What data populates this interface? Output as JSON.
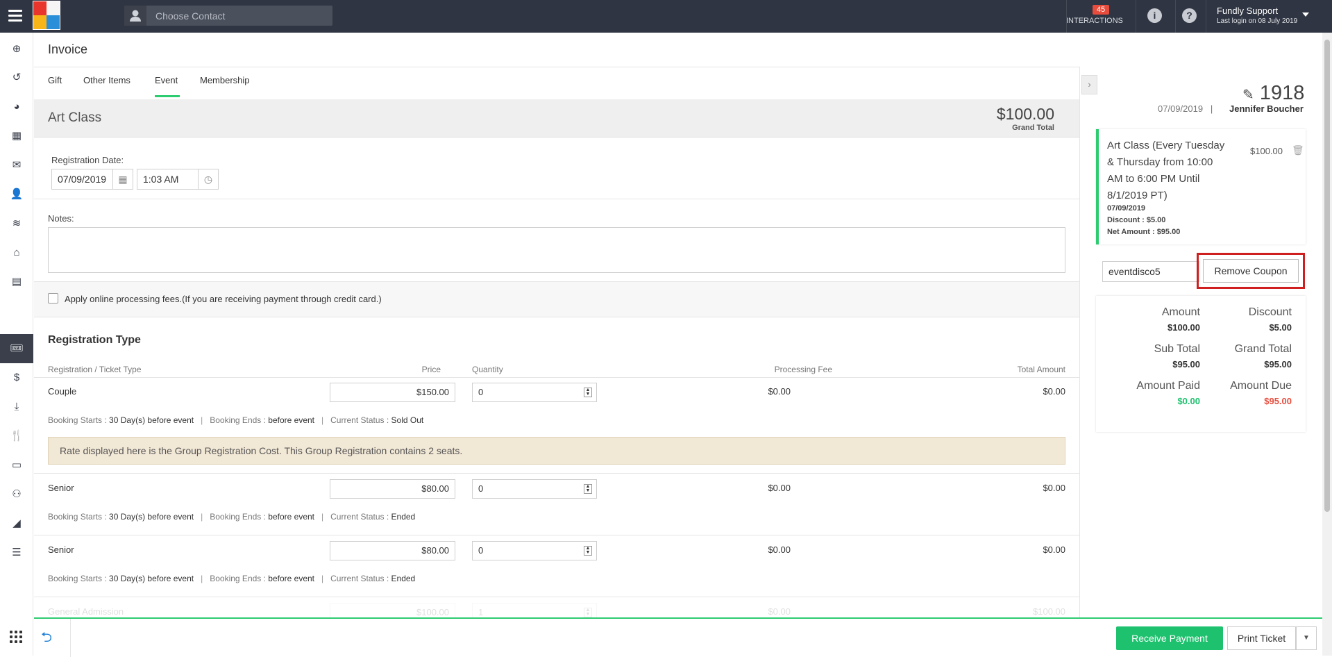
{
  "topbar": {
    "search_placeholder": "Choose Contact",
    "interactions_count": "45",
    "interactions_label": "INTERACTIONS",
    "user_name": "Fundly Support",
    "last_login": "Last login on 08 July 2019"
  },
  "colors": {
    "accent": "#2ecc71",
    "topbar": "#2f3542",
    "highlight": "#d01f1f"
  },
  "page": {
    "title": "Invoice",
    "tabs": [
      "Gift",
      "Other Items",
      "Event",
      "Membership"
    ],
    "active_tab": "Event"
  },
  "event": {
    "name": "Art Class",
    "grand_total": "$100.00",
    "grand_total_label": "Grand Total",
    "registration_date_label": "Registration Date:",
    "date": "07/09/2019",
    "time": "1:03 AM",
    "notes_label": "Notes:",
    "fees_label": "Apply online processing fees.(If you are receiving payment through credit card.)"
  },
  "registration": {
    "heading": "Registration Type",
    "headers": [
      "Registration / Ticket Type",
      "Price",
      "Quantity",
      "Processing Fee",
      "Total Amount"
    ],
    "rows": [
      {
        "type": "Couple",
        "price": "$150.00",
        "qty": "0",
        "fee": "$0.00",
        "total": "$0.00",
        "starts": "30 Day(s) before event",
        "ends": "before event",
        "status": "Sold Out"
      },
      {
        "type": "Senior",
        "price": "$80.00",
        "qty": "0",
        "fee": "$0.00",
        "total": "$0.00",
        "starts": "30 Day(s) before event",
        "ends": "before event",
        "status": "Ended"
      },
      {
        "type": "Senior",
        "price": "$80.00",
        "qty": "0",
        "fee": "$0.00",
        "total": "$0.00",
        "starts": "30 Day(s) before event",
        "ends": "before event",
        "status": "Ended"
      },
      {
        "type": "General Admission",
        "price": "$100.00",
        "qty": "1",
        "fee": "$0.00",
        "total": "$100.00"
      }
    ],
    "meta_labels": {
      "starts": "Booking Starts :",
      "ends": "Booking Ends :",
      "status": "Current Status :"
    },
    "group_note": "Rate displayed here is the Group Registration Cost. This Group Registration contains 2 seats."
  },
  "summary": {
    "invoice_no": "1918",
    "date": "07/09/2019",
    "sep": "|",
    "contact": "Jennifer Boucher",
    "item": {
      "title": "Art Class (Every Tuesday & Thursday from 10:00 AM to 6:00 PM Until 8/1/2019 PT)",
      "amount": "$100.00",
      "date": "07/09/2019",
      "discount": "Discount : $5.00",
      "net": "Net Amount : $95.00"
    },
    "coupon_code": "eventdisco5",
    "remove_coupon": "Remove Coupon",
    "amount_label": "Amount",
    "amount": "$100.00",
    "discount_label": "Discount",
    "discount": "$5.00",
    "subtotal_label": "Sub Total",
    "subtotal": "$95.00",
    "grandtotal_label": "Grand Total",
    "grandtotal": "$95.00",
    "paid_label": "Amount Paid",
    "paid": "$0.00",
    "due_label": "Amount Due",
    "due": "$95.00"
  },
  "footer": {
    "receive": "Receive Payment",
    "print": "Print Ticket"
  }
}
